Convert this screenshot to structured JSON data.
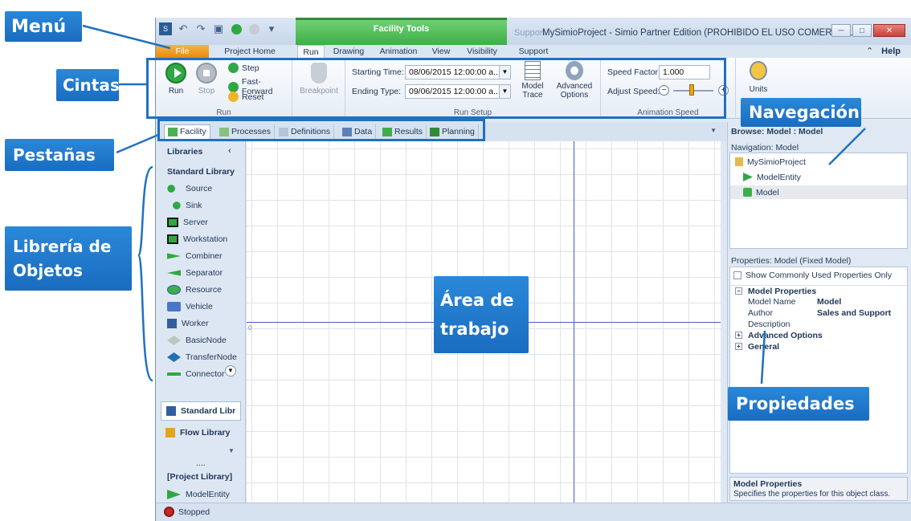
{
  "window": {
    "title": "MySimioProject - Simio Partner Edition (PROHIBIDO EL USO COMERCIAL...",
    "contextual_header": "Facility Tools",
    "support_header": "Support"
  },
  "ribbon_tabs": [
    "File",
    "Project Home",
    "Run",
    "Drawing",
    "Animation",
    "View",
    "Visibility",
    "Support"
  ],
  "help_label": "Help",
  "ribbon": {
    "run_group": {
      "label": "Run",
      "run": "Run",
      "stop": "Stop",
      "step": "Step",
      "fast_forward": "Fast-Forward",
      "reset": "Reset"
    },
    "breakpoint": "Breakpoint",
    "run_setup": {
      "label": "Run Setup",
      "starting_time_label": "Starting Time:",
      "starting_time_value": "08/06/2015 12:00:00 a...",
      "ending_type_label": "Ending Type:",
      "ending_type_value": "09/06/2015 12:00:00 a...",
      "model_trace": "Model Trace",
      "advanced_options": "Advanced Options"
    },
    "animation_speed": {
      "label": "Animation Speed",
      "speed_factor_label": "Speed Factor:",
      "speed_factor_value": "1.000",
      "adjust_speed_label": "Adjust Speed:"
    },
    "units": "Units"
  },
  "doc_tabs": [
    "Facility",
    "Processes",
    "Definitions",
    "Data",
    "Results",
    "Planning"
  ],
  "libraries": {
    "header": "Libraries",
    "standard_title": "Standard Library",
    "items": [
      "Source",
      "Sink",
      "Server",
      "Workstation",
      "Combiner",
      "Separator",
      "Resource",
      "Vehicle",
      "Worker",
      "BasicNode",
      "TransferNode",
      "Connector"
    ],
    "sections": [
      "Standard Libr",
      "Flow Library"
    ],
    "dots": "....",
    "project_library": "[Project Library]",
    "project_items": [
      "ModelEntity",
      "Model"
    ]
  },
  "canvas": {
    "origin_label": "0"
  },
  "browse": {
    "header": "Browse: Model : Model",
    "navigation_header": "Navigation: Model",
    "nav_items": [
      "MySimioProject",
      "ModelEntity",
      "Model"
    ]
  },
  "properties": {
    "header": "Properties: Model (Fixed Model)",
    "show_common": "Show Commonly Used Properties Only",
    "section_model": "Model Properties",
    "rows": [
      {
        "key": "Model Name",
        "value": "Model"
      },
      {
        "key": "Author",
        "value": "Sales and Support"
      },
      {
        "key": "Description",
        "value": ""
      }
    ],
    "section_advanced": "Advanced Options",
    "section_general": "General",
    "help_title": "Model Properties",
    "help_text": "Specifies the properties for this object class."
  },
  "status": "Stopped",
  "annotations": {
    "menu": "Menú",
    "cintas": "Cintas",
    "pestanas": "Pestañas",
    "libreria_1": "Librería de",
    "libreria_2": "Objetos",
    "area_1": "Área de",
    "area_2": "trabajo",
    "navegacion": "Navegación",
    "propiedades": "Propiedades"
  },
  "colors": {
    "annotation_blue": "#1a6cc0",
    "run_green": "#2fa843",
    "file_tab_orange": "#e68a10",
    "axis_blue": "#4b59c7"
  }
}
